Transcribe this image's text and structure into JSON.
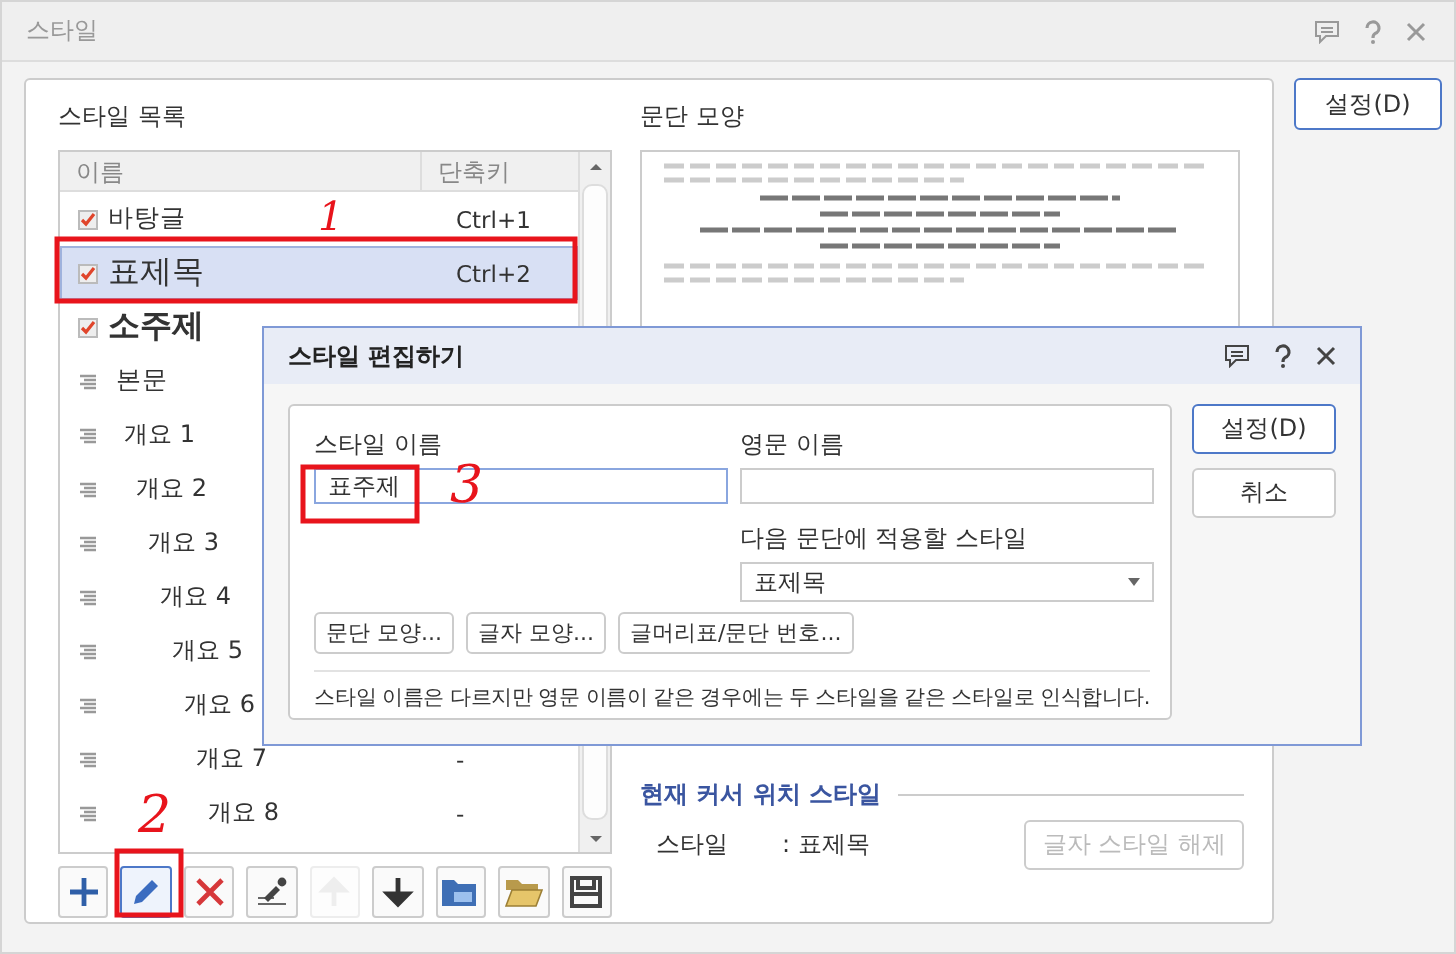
{
  "window": {
    "title": "스타일"
  },
  "style_list": {
    "label": "스타일 목록",
    "columns": [
      "이름",
      "단축키"
    ],
    "rows": [
      {
        "name": "바탕글",
        "shortcut": "Ctrl+1",
        "kind": "plain",
        "checked": true,
        "selected": false,
        "annotation": "1"
      },
      {
        "name": "표제목",
        "shortcut": "Ctrl+2",
        "kind": "title",
        "checked": true,
        "selected": true
      },
      {
        "name": "소주제",
        "kind": "subtitle",
        "checked": true,
        "selected": false
      },
      {
        "name": "본문",
        "kind": "body",
        "checked": false,
        "selected": false
      },
      {
        "name": "개요 1",
        "kind": "outline",
        "checked": false,
        "selected": false
      },
      {
        "name": "개요 2",
        "kind": "outline",
        "checked": false,
        "selected": false
      },
      {
        "name": "개요 3",
        "kind": "outline",
        "checked": false,
        "selected": false
      },
      {
        "name": "개요 4",
        "kind": "outline",
        "checked": false,
        "selected": false
      },
      {
        "name": "개요 5",
        "kind": "outline",
        "checked": false,
        "selected": false
      },
      {
        "name": "개요 6",
        "kind": "outline",
        "checked": false,
        "selected": false
      },
      {
        "name": "개요 7",
        "shortcut": "-",
        "kind": "outline",
        "checked": false,
        "selected": false
      },
      {
        "name": "개요 8",
        "shortcut": "-",
        "kind": "outline",
        "checked": false,
        "selected": false,
        "annotation": "2"
      }
    ]
  },
  "toolbar": [
    {
      "kind": "add",
      "disabled": false,
      "selected": false
    },
    {
      "kind": "edit",
      "disabled": false,
      "selected": true
    },
    {
      "kind": "delete",
      "disabled": false,
      "selected": false
    },
    {
      "kind": "eyedropper",
      "disabled": false,
      "selected": false
    },
    {
      "kind": "up",
      "disabled": true,
      "selected": false
    },
    {
      "kind": "down",
      "disabled": false,
      "selected": false
    },
    {
      "kind": "import",
      "disabled": false,
      "selected": false
    },
    {
      "kind": "open",
      "disabled": false,
      "selected": false
    },
    {
      "kind": "save",
      "disabled": false,
      "selected": false
    }
  ],
  "preview": {
    "label": "문단 모양"
  },
  "current_style": {
    "heading": "현재 커서 위치 스타일",
    "label": "스타일",
    "value": ": 표제목",
    "clear_button": "글자 스타일 해제",
    "clear_disabled": true
  },
  "ok_button": "설정(D)",
  "dialog": {
    "title": "스타일 편집하기",
    "name_label": "스타일 이름",
    "name_value": "표주제",
    "name_annotation": "3",
    "english_label": "영문 이름",
    "next_label": "다음 문단에 적용할 스타일",
    "next_value": "표제목",
    "buttons": [
      "문단 모양...",
      "글자 모양...",
      "글머리표/문단 번호..."
    ],
    "note": "스타일 이름은 다르지만 영문 이름이 같은 경우에는 두 스타일을 같은 스타일로 인식합니다.",
    "ok": "설정(D)",
    "cancel": "취소"
  }
}
